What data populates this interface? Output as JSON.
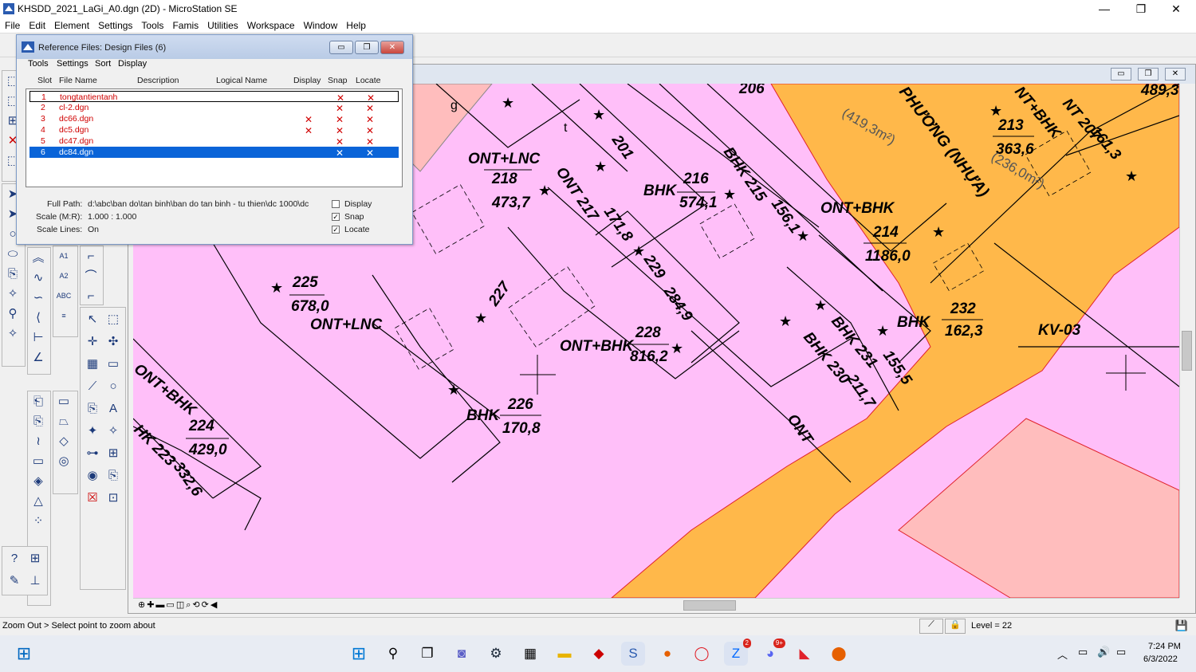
{
  "window": {
    "title": "KHSDD_2021_LaGi_A0.dgn (2D) - MicroStation SE",
    "min": "—",
    "max": "❐",
    "close": "✕"
  },
  "menu": [
    "File",
    "Edit",
    "Element",
    "Settings",
    "Tools",
    "Famis",
    "Utilities",
    "Workspace",
    "Window",
    "Help"
  ],
  "ref_dialog": {
    "title": "Reference Files: Design Files (6)",
    "menu": [
      "Tools",
      "Settings",
      "Sort",
      "Display"
    ],
    "columns": [
      "Slot",
      "File Name",
      "Description",
      "Logical Name",
      "Display",
      "Snap",
      "Locate"
    ],
    "rows": [
      {
        "slot": "1",
        "file": "tongtantientanh",
        "display": "",
        "snap": "✕",
        "locate": "✕"
      },
      {
        "slot": "2",
        "file": "cl-2.dgn",
        "display": "",
        "snap": "✕",
        "locate": "✕"
      },
      {
        "slot": "3",
        "file": "dc66.dgn",
        "display": "✕",
        "snap": "✕",
        "locate": "✕"
      },
      {
        "slot": "4",
        "file": "dc5.dgn",
        "display": "✕",
        "snap": "✕",
        "locate": "✕"
      },
      {
        "slot": "5",
        "file": "dc47.dgn",
        "display": "",
        "snap": "✕",
        "locate": "✕"
      },
      {
        "slot": "6",
        "file": "dc84.dgn",
        "display": "",
        "snap": "✕",
        "locate": "✕"
      }
    ],
    "full_path_label": "Full Path:",
    "full_path": "d:\\abc\\ban do\\tan binh\\ban do tan binh - tu thien\\dc 1000\\dc",
    "scale_label": "Scale (M:R):",
    "scale": "1.000 : 1.000",
    "scale_lines_label": "Scale Lines:",
    "scale_lines": "On",
    "opt_display": "Display",
    "opt_snap": "Snap",
    "opt_locate": "Locate",
    "opt_display_checked": false,
    "opt_snap_checked": true,
    "opt_locate_checked": true
  },
  "map": {
    "labels": [
      "ONT+LNC",
      "218",
      "473,7",
      "BHK",
      "216",
      "574,1",
      "201",
      "206",
      "ONT 217",
      "171,8",
      "BHK 215",
      "156,1",
      "229",
      "284,9",
      "225",
      "678,0",
      "ONT+LNC",
      "227",
      "228",
      "ONT+BHK",
      "816,2",
      "226",
      "BHK",
      "170,8",
      "ONT+BHK",
      "224",
      "429,0",
      "HK 223",
      "332,6",
      "ONT+BHK",
      "214",
      "1186,0",
      "BHK",
      "232",
      "162,3",
      "KV-03",
      "BHK 231",
      "155,5",
      "BHK 230",
      "211,7",
      "ONT",
      "213",
      "363,6",
      "NT+BHK",
      "NT 207",
      "161,3",
      "489,3",
      "(419,3m²)",
      "(236,0m²)",
      "PHƯƠNG (NHỰA)",
      "g",
      "t"
    ]
  },
  "status": {
    "prompt": "Zoom Out > Select point to zoom about",
    "level": "Level = 22"
  },
  "taskbar": {
    "time": "7:24 PM",
    "date": "6/3/2022",
    "badge_zalo": "2",
    "badge_discord": "9+"
  },
  "colors": {
    "parcel_fill": "#ffbff9",
    "road_fill": "#ffb84a",
    "rice_fill": "#ffbdbd",
    "selected_row": "#0a64d8",
    "ref_text": "#d00000"
  }
}
